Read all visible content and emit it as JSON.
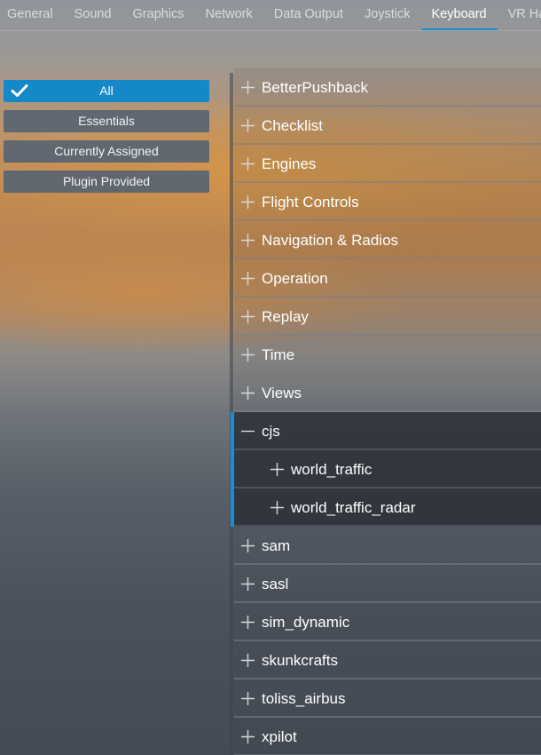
{
  "tabs": [
    {
      "label": "General",
      "active": false
    },
    {
      "label": "Sound",
      "active": false
    },
    {
      "label": "Graphics",
      "active": false
    },
    {
      "label": "Network",
      "active": false
    },
    {
      "label": "Data Output",
      "active": false
    },
    {
      "label": "Joystick",
      "active": false
    },
    {
      "label": "Keyboard",
      "active": true
    },
    {
      "label": "VR Hard",
      "active": false
    }
  ],
  "filters": [
    {
      "label": "All",
      "selected": true
    },
    {
      "label": "Essentials",
      "selected": false
    },
    {
      "label": "Currently Assigned",
      "selected": false
    },
    {
      "label": "Plugin Provided",
      "selected": false
    }
  ],
  "tree": [
    {
      "label": "BetterPushback",
      "state": "collapsed",
      "level": 0
    },
    {
      "label": "Checklist",
      "state": "collapsed",
      "level": 0
    },
    {
      "label": "Engines",
      "state": "collapsed",
      "level": 0
    },
    {
      "label": "Flight Controls",
      "state": "collapsed",
      "level": 0
    },
    {
      "label": "Navigation & Radios",
      "state": "collapsed",
      "level": 0
    },
    {
      "label": "Operation",
      "state": "collapsed",
      "level": 0
    },
    {
      "label": "Replay",
      "state": "collapsed",
      "level": 0
    },
    {
      "label": "Time",
      "state": "collapsed",
      "level": 0
    },
    {
      "label": "Views",
      "state": "collapsed",
      "level": 0
    },
    {
      "label": "cjs",
      "state": "expanded",
      "level": 0
    },
    {
      "label": "world_traffic",
      "state": "collapsed",
      "level": 1
    },
    {
      "label": "world_traffic_radar",
      "state": "collapsed",
      "level": 1
    },
    {
      "label": "sam",
      "state": "collapsed",
      "level": 0
    },
    {
      "label": "sasl",
      "state": "collapsed",
      "level": 0
    },
    {
      "label": "sim_dynamic",
      "state": "collapsed",
      "level": 0
    },
    {
      "label": "skunkcrafts",
      "state": "collapsed",
      "level": 0
    },
    {
      "label": "toliss_airbus",
      "state": "collapsed",
      "level": 0
    },
    {
      "label": "xpilot",
      "state": "collapsed",
      "level": 0
    }
  ],
  "colors": {
    "accent": "#1590d2",
    "selected_button": "#1588c8",
    "button": "#586472"
  },
  "icons": {
    "expand": "plus-icon",
    "collapse": "minus-icon",
    "selected": "check-icon"
  }
}
